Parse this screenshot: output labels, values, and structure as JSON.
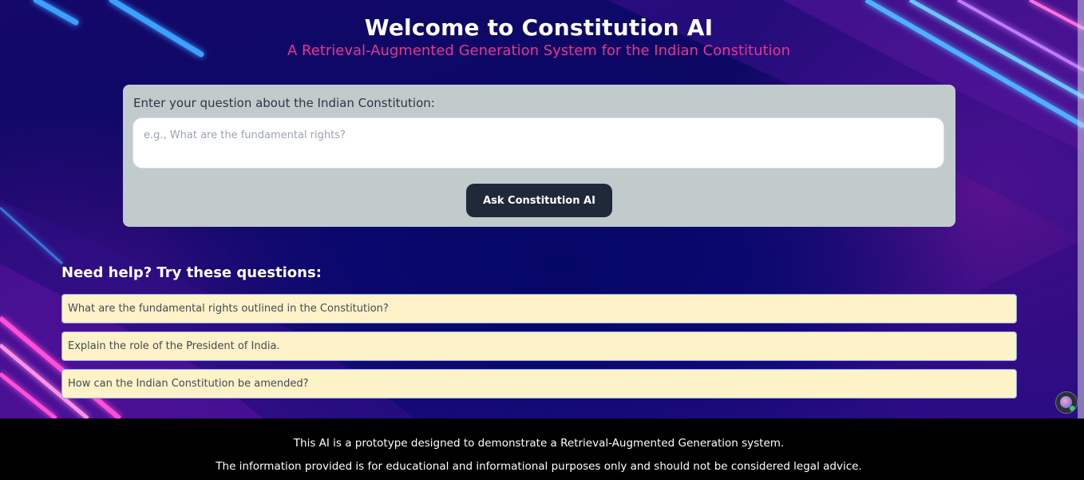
{
  "header": {
    "title": "Welcome to Constitution AI",
    "subtitle": "A Retrieval-Augmented Generation System for the Indian Constitution"
  },
  "question_form": {
    "label": "Enter your question about the Indian Constitution:",
    "input_value": "",
    "input_placeholder": "e.g., What are the fundamental rights?",
    "submit_label": "Ask Constitution AI"
  },
  "help": {
    "title": "Need help? Try these questions:",
    "suggestions": [
      "What are the fundamental rights outlined in the Constitution?",
      "Explain the role of the President of India.",
      "How can the Indian Constitution be amended?"
    ]
  },
  "footer": {
    "line1": "This AI is a prototype designed to demonstrate a Retrieval-Augmented Generation system.",
    "line2": "The information provided is for educational and informational purposes only and should not be considered legal advice."
  },
  "colors": {
    "subtitle": "#e6368f",
    "card_bg": "#c1cbcb",
    "button_bg": "#1f2937",
    "suggestion_bg": "#fdf2c8",
    "suggestion_border": "#8aa6e6",
    "neon_pink": "#ff3fc8",
    "neon_blue": "#3fa8ff"
  },
  "icons": {
    "floating_avatar": "assistant-avatar-icon"
  }
}
